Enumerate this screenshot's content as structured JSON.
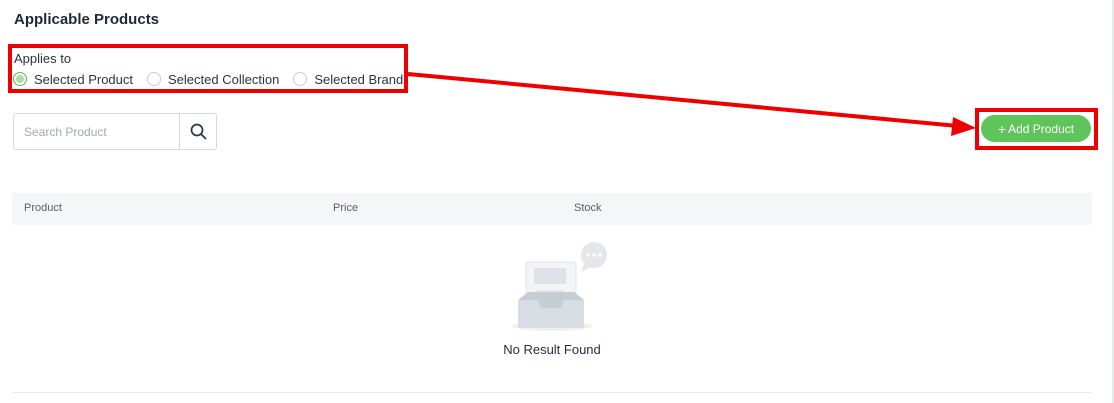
{
  "section": {
    "title": "Applicable Products"
  },
  "applies": {
    "label": "Applies to",
    "options": [
      {
        "label": "Selected Product",
        "checked": true
      },
      {
        "label": "Selected Collection",
        "checked": false
      },
      {
        "label": "Selected Brand",
        "checked": false
      }
    ]
  },
  "search": {
    "placeholder": "Search Product",
    "value": ""
  },
  "toolbar": {
    "add_label": "Add Product",
    "add_icon": "+"
  },
  "table": {
    "columns": [
      "Product",
      "Price",
      "Stock"
    ],
    "empty_text": "No Result Found"
  },
  "annotation": {
    "color": "#ee0000"
  },
  "colors": {
    "accent": "#5fc45a"
  }
}
